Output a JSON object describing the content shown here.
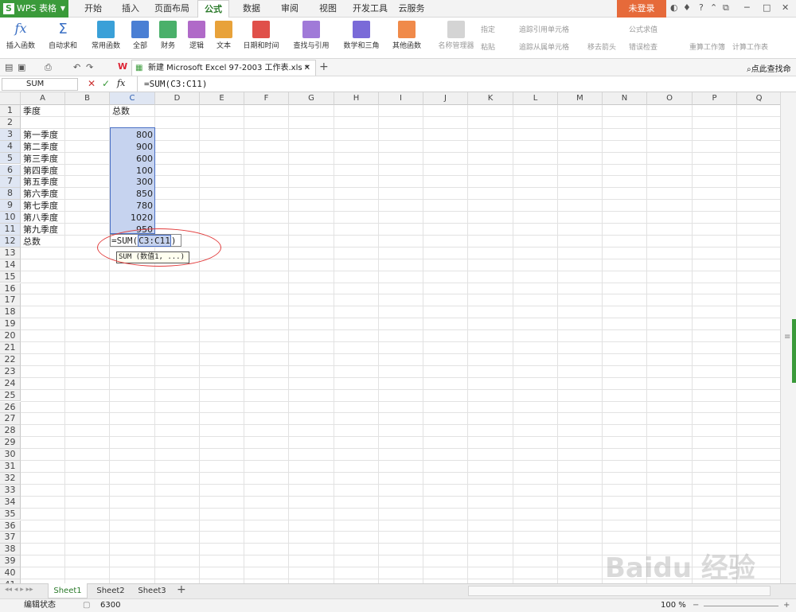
{
  "app": {
    "name": "WPS 表格",
    "login": "未登录"
  },
  "menu_tabs": [
    "开始",
    "插入",
    "页面布局",
    "公式",
    "数据",
    "审阅",
    "视图",
    "开发工具",
    "云服务"
  ],
  "active_tab": "公式",
  "ribbon": {
    "buttons": [
      "插入函数",
      "自动求和",
      "常用函数",
      "全部",
      "财务",
      "逻辑",
      "文本",
      "日期和时间",
      "查找与引用",
      "数学和三角",
      "其他函数",
      "名称管理器"
    ],
    "small": [
      "指定",
      "粘贴",
      "追踪引用单元格",
      "追踪从属单元格",
      "移去箭头",
      "公式求值",
      "错误检查"
    ],
    "right": [
      "重算工作簿",
      "计算工作表"
    ]
  },
  "document_tab": "新建 Microsoft Excel 97-2003 工作表.xls *",
  "search_command": "点此查找命令",
  "name_box": "SUM",
  "formula": "=SUM(C3:C11)",
  "columns": [
    "A",
    "B",
    "C",
    "D",
    "E",
    "F",
    "G",
    "H",
    "I",
    "J",
    "K",
    "L",
    "M",
    "N",
    "O",
    "P",
    "Q"
  ],
  "row_count": 41,
  "cells": {
    "A1": "季度",
    "C1": "总数",
    "A3": "第一季度",
    "A4": "第二季度",
    "A5": "第三季度",
    "A6": "第四季度",
    "A7": "第五季度",
    "A8": "第六季度",
    "A9": "第七季度",
    "A10": "第八季度",
    "A11": "第九季度",
    "A12": "总数"
  },
  "values": [
    "800",
    "900",
    "600",
    "100",
    "300",
    "850",
    "780",
    "1020",
    "950"
  ],
  "edit": {
    "prefix": "=SUM(",
    "ref": "C3:C11",
    "suffix": ")"
  },
  "tooltip": "SUM (数值1, ...)",
  "sheets": [
    "Sheet1",
    "Sheet2",
    "Sheet3"
  ],
  "active_sheet": "Sheet1",
  "status": {
    "mode": "编辑状态",
    "value": "6300",
    "zoom": "100 %"
  },
  "watermark": "Baidu 经验"
}
